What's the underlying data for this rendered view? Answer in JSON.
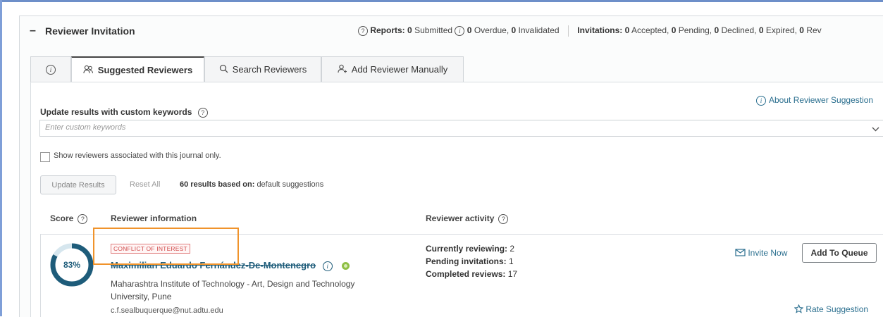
{
  "header": {
    "title": "Reviewer Invitation",
    "reports_label": "Reports:",
    "submitted_count": "0",
    "submitted_label": "Submitted",
    "overdue_count": "0",
    "overdue_label": "Overdue,",
    "invalidated_count": "0",
    "invalidated_label": "Invalidated",
    "invitations_label": "Invitations:",
    "accepted_count": "0",
    "accepted_label": "Accepted,",
    "pending_count": "0",
    "pending_label": "Pending,",
    "declined_count": "0",
    "declined_label": "Declined,",
    "expired_count": "0",
    "expired_label": "Expired,",
    "rev_count": "0",
    "rev_label": "Rev"
  },
  "tabs": [
    {
      "label": "Suggested Reviewers",
      "icon": "people-icon",
      "active": true
    },
    {
      "label": "Search Reviewers",
      "icon": "search-icon",
      "active": false
    },
    {
      "label": "Add Reviewer Manually",
      "icon": "person-add-icon",
      "active": false
    }
  ],
  "about_link": "About Reviewer Suggestion",
  "keywords": {
    "label": "Update results with custom keywords",
    "placeholder": "Enter custom keywords"
  },
  "journal_only_label": "Show reviewers associated with this journal only.",
  "update_button": "Update Results",
  "reset_all": "Reset All",
  "results_count_text": "60 results based on:",
  "results_source": "default suggestions",
  "columns": {
    "score": "Score",
    "info": "Reviewer information",
    "activity": "Reviewer activity"
  },
  "reviewer": {
    "score_text": "83%",
    "score_value": 0.83,
    "conflict_badge": "CONFLICT OF INTEREST",
    "name": "Maximilian Eduardo Fernández-De-Montenegro",
    "affiliation": "Maharashtra Institute of Technology - Art, Design and Technology University, Pune",
    "email": "c.f.sealbuquerque@nut.adtu.edu",
    "currently_reviewing_label": "Currently reviewing:",
    "currently_reviewing": "2",
    "pending_invitations_label": "Pending invitations:",
    "pending_invitations": "1",
    "completed_reviews_label": "Completed reviews:",
    "completed_reviews": "17",
    "invite_now": "Invite Now",
    "add_to_queue": "Add To Queue",
    "rate_suggestion": "Rate Suggestion"
  },
  "colors": {
    "accent": "#1e5c7a",
    "link": "#2b6f8f",
    "conflict": "#d04a4a",
    "highlight": "#f0932b",
    "ring_track": "#d6e6ee"
  }
}
